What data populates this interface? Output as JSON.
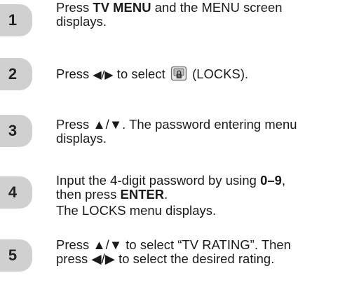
{
  "steps": [
    {
      "number": "1",
      "lines": [
        {
          "before": "Press ",
          "bold": "TV MENU",
          "after": " and the MENU screen"
        },
        {
          "text": "displays."
        }
      ]
    },
    {
      "number": "2",
      "press": "Press ",
      "arrows": "◀/▶",
      "mid": " to select ",
      "icon": "locks-icon",
      "after": " (LOCKS)."
    },
    {
      "number": "3",
      "lines": [
        {
          "text": "Press ▲/▼. The password entering menu"
        },
        {
          "text": "displays."
        }
      ]
    },
    {
      "number": "4",
      "line1": {
        "before": "Input the 4-digit password by using ",
        "bold": "0–9",
        "after": ","
      },
      "line2": {
        "before": "then press ",
        "bold": "ENTER",
        "after": "."
      },
      "line3": "The LOCKS menu displays."
    },
    {
      "number": "5",
      "lines": [
        {
          "text": "Press ▲/▼ to select “TV RATING”. Then"
        },
        {
          "text": "press ◀/▶ to select the desired rating."
        }
      ]
    }
  ],
  "colors": {
    "badge": "#d0d0d0",
    "text": "#1a1a1a"
  }
}
